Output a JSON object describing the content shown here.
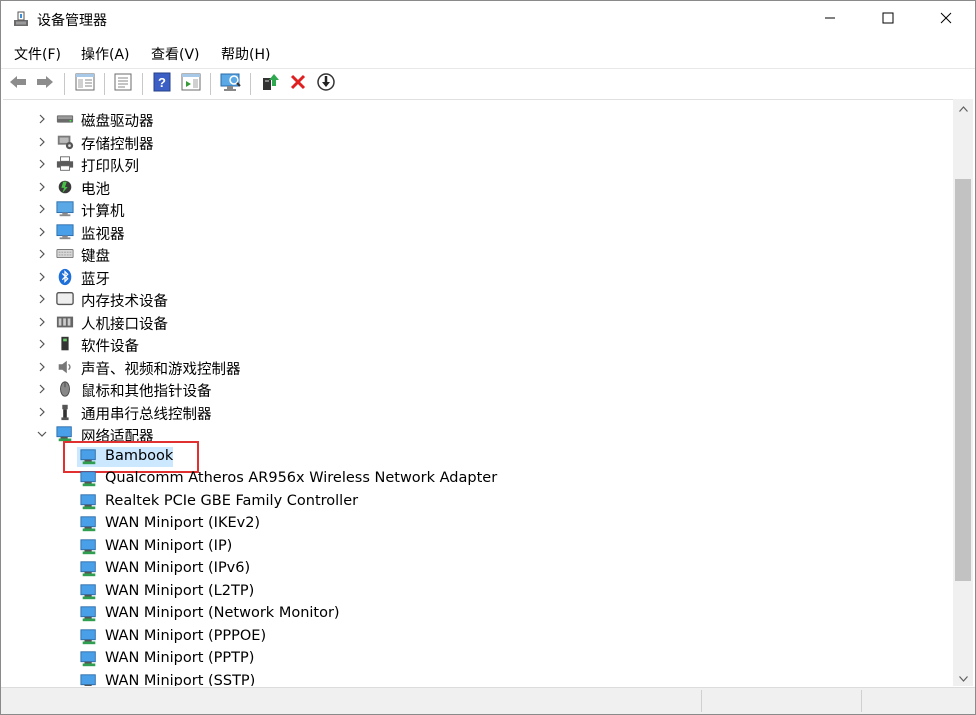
{
  "window": {
    "title": "设备管理器",
    "icon": "device-manager-icon"
  },
  "menu": [
    {
      "label": "文件(F)"
    },
    {
      "label": "操作(A)"
    },
    {
      "label": "查看(V)"
    },
    {
      "label": "帮助(H)"
    }
  ],
  "toolbar": [
    {
      "icon": "back-arrow-icon"
    },
    {
      "icon": "forward-arrow-icon"
    },
    {
      "icon": "show-hide-console-tree-icon"
    },
    {
      "icon": "properties-icon"
    },
    {
      "icon": "help-icon"
    },
    {
      "icon": "action-pane-icon"
    },
    {
      "icon": "scan-hardware-changes-icon"
    },
    {
      "icon": "update-driver-icon"
    },
    {
      "icon": "uninstall-device-icon"
    },
    {
      "icon": "disable-device-icon"
    }
  ],
  "tree": {
    "categories": [
      {
        "label": "磁盘驱动器",
        "icon": "disk-drive-icon",
        "expanded": false
      },
      {
        "label": "存储控制器",
        "icon": "storage-controller-icon",
        "expanded": false
      },
      {
        "label": "打印队列",
        "icon": "printer-icon",
        "expanded": false
      },
      {
        "label": "电池",
        "icon": "battery-icon",
        "expanded": false
      },
      {
        "label": "计算机",
        "icon": "computer-icon",
        "expanded": false
      },
      {
        "label": "监视器",
        "icon": "monitor-icon",
        "expanded": false
      },
      {
        "label": "键盘",
        "icon": "keyboard-icon",
        "expanded": false
      },
      {
        "label": "蓝牙",
        "icon": "bluetooth-icon",
        "expanded": false
      },
      {
        "label": "内存技术设备",
        "icon": "memory-device-icon",
        "expanded": false
      },
      {
        "label": "人机接口设备",
        "icon": "hid-icon",
        "expanded": false
      },
      {
        "label": "软件设备",
        "icon": "software-device-icon",
        "expanded": false
      },
      {
        "label": "声音、视频和游戏控制器",
        "icon": "speaker-icon",
        "expanded": false
      },
      {
        "label": "鼠标和其他指针设备",
        "icon": "mouse-icon",
        "expanded": false
      },
      {
        "label": "通用串行总线控制器",
        "icon": "usb-icon",
        "expanded": false
      },
      {
        "label": "网络适配器",
        "icon": "network-adapter-icon",
        "expanded": true
      }
    ],
    "network_adapters": [
      {
        "label": "Bambook",
        "selected": true
      },
      {
        "label": "Qualcomm Atheros AR956x Wireless Network Adapter"
      },
      {
        "label": "Realtek PCIe GBE Family Controller"
      },
      {
        "label": "WAN Miniport (IKEv2)"
      },
      {
        "label": "WAN Miniport (IP)"
      },
      {
        "label": "WAN Miniport (IPv6)"
      },
      {
        "label": "WAN Miniport (L2TP)"
      },
      {
        "label": "WAN Miniport (Network Monitor)"
      },
      {
        "label": "WAN Miniport (PPPOE)"
      },
      {
        "label": "WAN Miniport (PPTP)"
      },
      {
        "label": "WAN Miniport (SSTP)"
      }
    ]
  },
  "colors": {
    "selection": "#cce8ff",
    "highlight_box": "#e0302f",
    "network_icon": "#3c8fd6"
  }
}
